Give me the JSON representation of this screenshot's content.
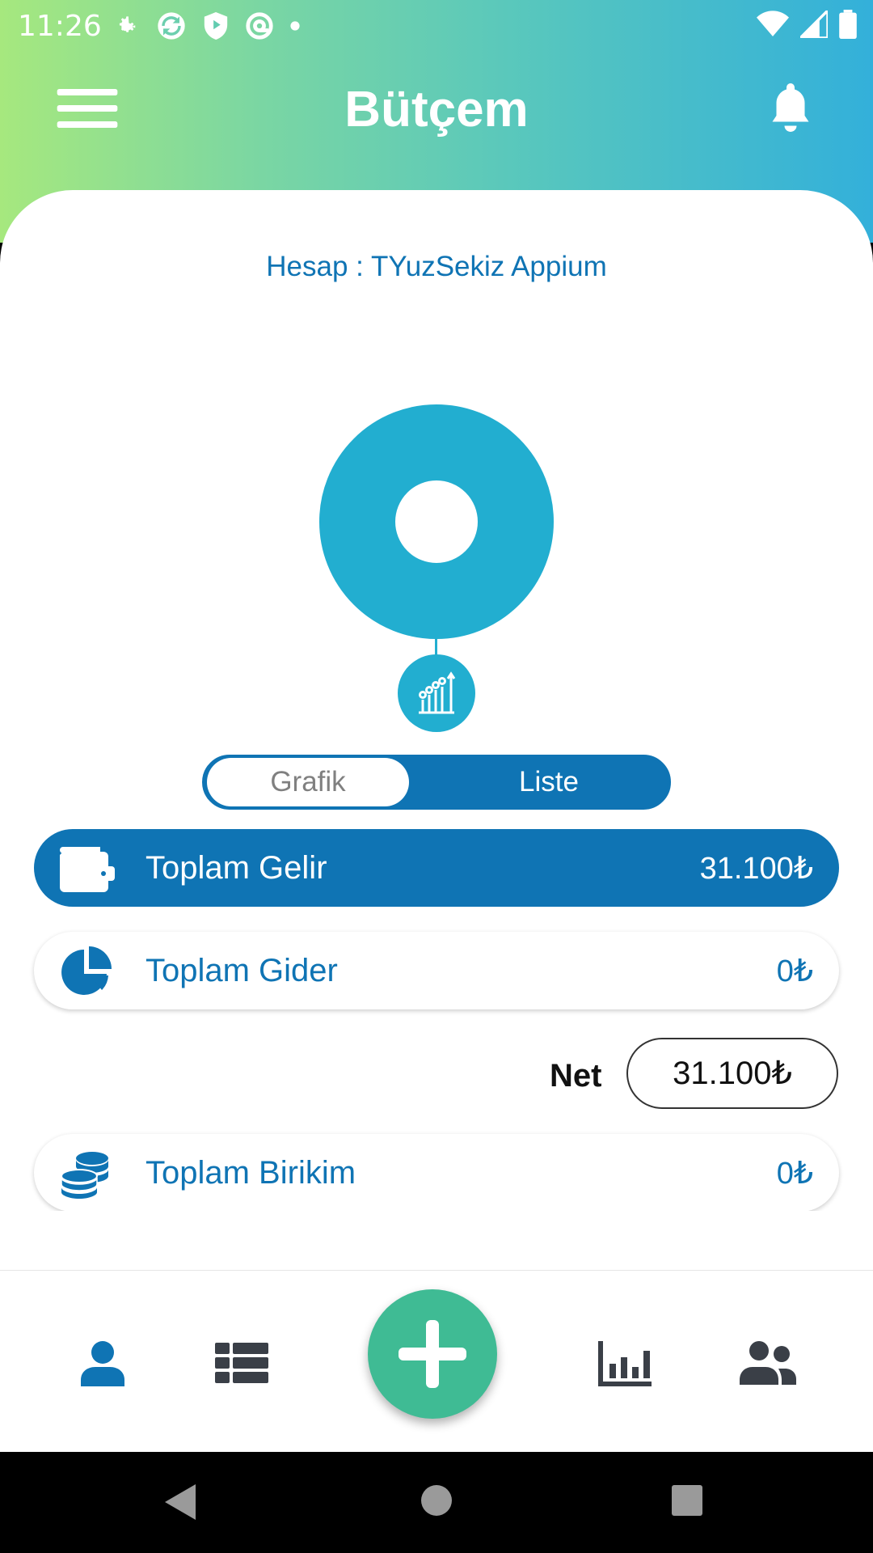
{
  "status_bar": {
    "time": "11:26"
  },
  "app": {
    "title": "Bütçem"
  },
  "account": {
    "text": "Hesap : TYuzSekiz Appium"
  },
  "view_toggle": {
    "options": [
      "Grafik",
      "Liste"
    ],
    "selected": "Liste"
  },
  "summary": {
    "income": {
      "label": "Toplam Gelir",
      "value": "31.100₺",
      "icon": "wallet-icon"
    },
    "expense": {
      "label": "Toplam Gider",
      "value": "0₺",
      "icon": "pie-chart-icon"
    },
    "net": {
      "label": "Net",
      "value": "31.100₺"
    },
    "savings": {
      "label": "Toplam Birikim",
      "value": "0₺",
      "icon": "coins-icon"
    }
  },
  "bottom_nav": {
    "items": [
      "person-icon",
      "list-icon",
      "add-icon",
      "bar-chart-icon",
      "users-icon"
    ]
  },
  "colors": {
    "primary": "#0f74b4",
    "chart": "#22aed0",
    "fab": "#3fbb94",
    "gradient_start": "#a6e87e",
    "gradient_end": "#33b0da"
  }
}
